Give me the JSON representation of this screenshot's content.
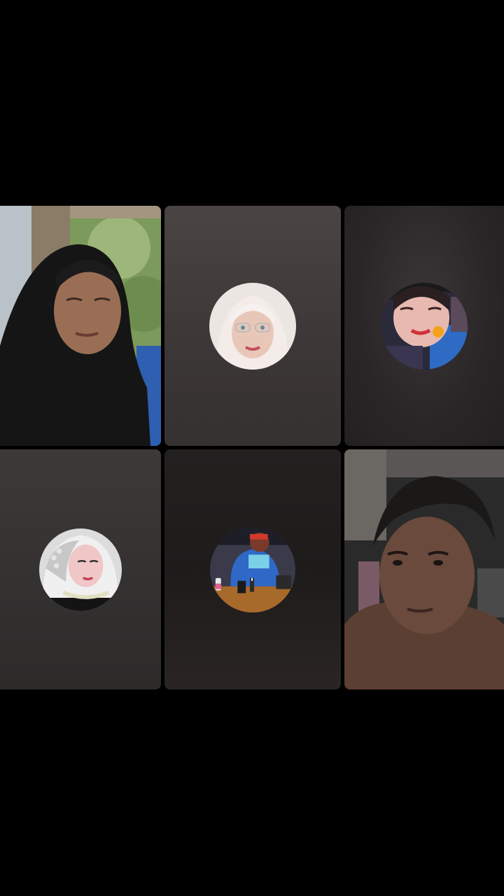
{
  "screen": {
    "background": "#000000"
  },
  "participants": [
    {
      "id": "p1",
      "mode": "live-video",
      "feed": "woman-in-black-hijab"
    },
    {
      "id": "p2",
      "mode": "profile-avatar",
      "avatar": "woman-white-hijab-glasses"
    },
    {
      "id": "p3",
      "mode": "profile-avatar",
      "avatar": "woman-selfie-dark"
    },
    {
      "id": "p4",
      "mode": "profile-avatar",
      "avatar": "bride-white-veil"
    },
    {
      "id": "p5",
      "mode": "profile-avatar",
      "avatar": "man-blue-shirt-table"
    },
    {
      "id": "p6",
      "mode": "live-video",
      "feed": "man-dim-room"
    }
  ],
  "colors": {
    "tile_gray": "#433e3d",
    "tile_dark": "#2a2627"
  }
}
